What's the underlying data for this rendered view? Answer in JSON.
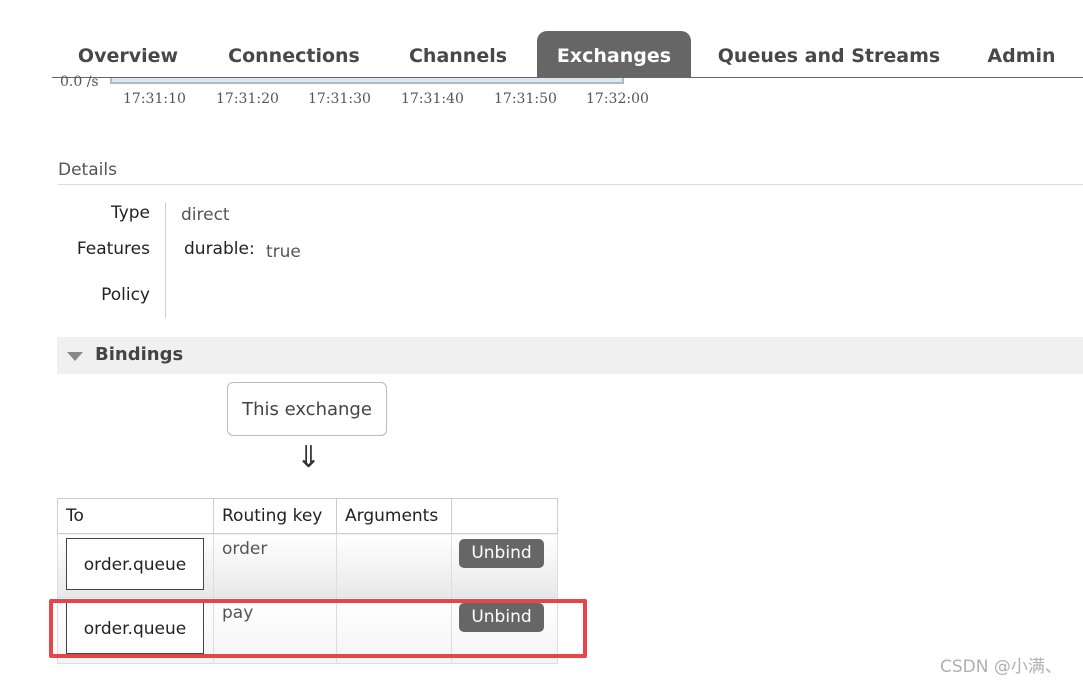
{
  "tabs": [
    {
      "label": "Overview",
      "active": false
    },
    {
      "label": "Connections",
      "active": false
    },
    {
      "label": "Channels",
      "active": false
    },
    {
      "label": "Exchanges",
      "active": true
    },
    {
      "label": "Queues and Streams",
      "active": false
    },
    {
      "label": "Admin",
      "active": false
    }
  ],
  "rate_chart": {
    "rate_label": "0.0 /s",
    "time_ticks": [
      "17:31:10",
      "17:31:20",
      "17:31:30",
      "17:31:40",
      "17:31:50",
      "17:32:00"
    ]
  },
  "details": {
    "title": "Details",
    "type_label": "Type",
    "type_value": "direct",
    "features_label": "Features",
    "feature_key": "durable:",
    "feature_value": "true",
    "policy_label": "Policy"
  },
  "bindings": {
    "title": "Bindings",
    "source_label": "This exchange",
    "arrow": "⇓",
    "columns": [
      "To",
      "Routing key",
      "Arguments",
      ""
    ],
    "rows": [
      {
        "to": "order.queue",
        "routing_key": "order",
        "arguments": "",
        "action": "Unbind"
      },
      {
        "to": "order.queue",
        "routing_key": "pay",
        "arguments": "",
        "action": "Unbind"
      }
    ]
  },
  "watermark": "CSDN @小满、",
  "colors": {
    "tab_active_bg": "#666666",
    "highlight": "#e8454a",
    "button_bg": "#666666"
  }
}
